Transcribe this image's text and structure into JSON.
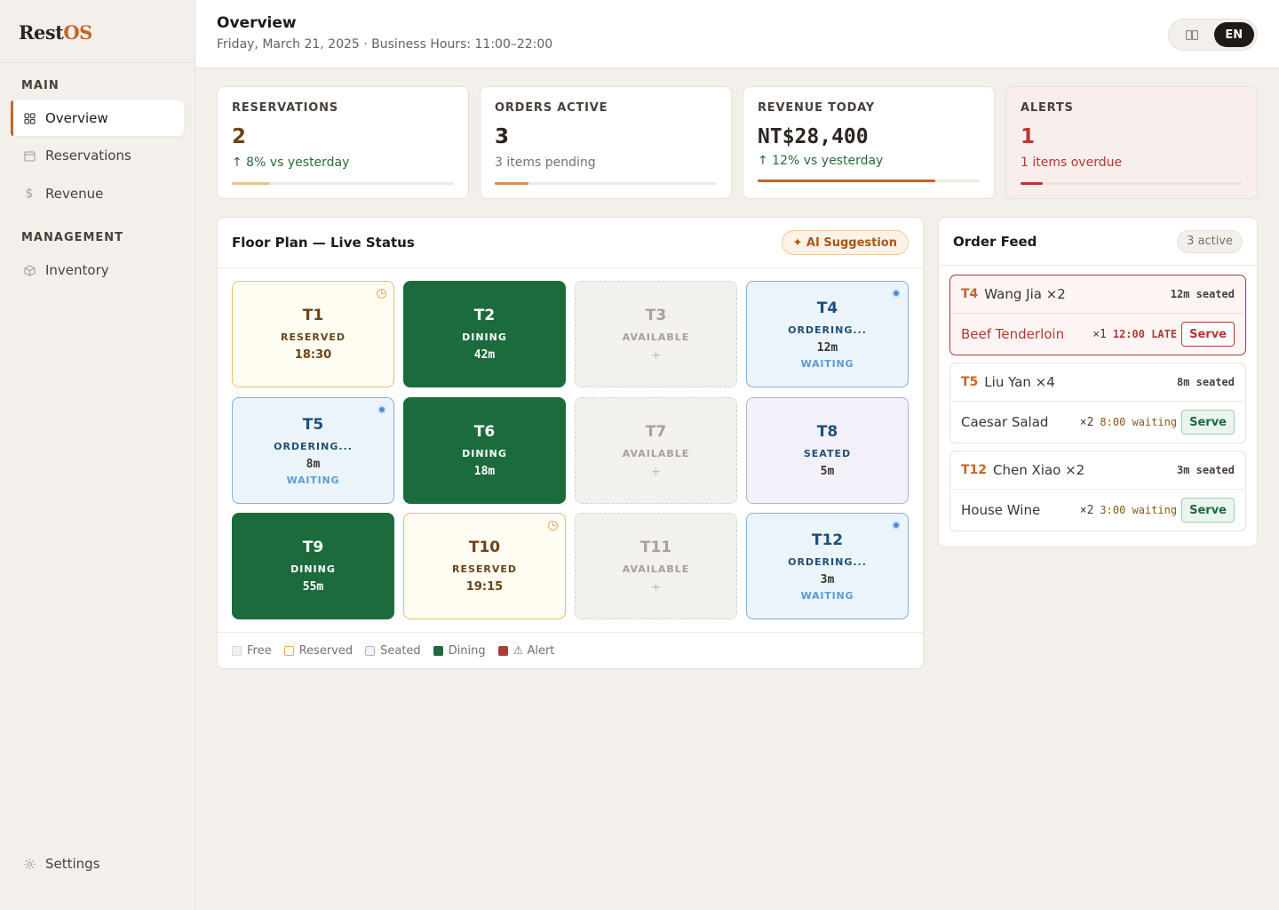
{
  "brand": {
    "part1": "Rest",
    "part2": "OS"
  },
  "sidebar": {
    "section_main": "MAIN",
    "section_management": "MANAGEMENT",
    "items": [
      {
        "label": "Overview",
        "icon": "grid-icon"
      },
      {
        "label": "Reservations",
        "icon": "calendar-icon"
      },
      {
        "label": "Revenue",
        "icon": "dollar-icon"
      },
      {
        "label": "Inventory",
        "icon": "box-icon"
      }
    ],
    "settings": {
      "label": "Settings",
      "icon": "gear-icon"
    }
  },
  "header": {
    "title": "Overview",
    "subtitle": "Friday, March 21, 2025 · Business Hours: 11:00–22:00",
    "lang": {
      "options": [
        "中",
        "EN"
      ],
      "active": "EN"
    }
  },
  "stats": [
    {
      "label": "RESERVATIONS",
      "value": "2",
      "note": "↑ 8% vs yesterday",
      "progress": 0.17,
      "bar_color": "#e8c28f"
    },
    {
      "label": "ORDERS ACTIVE",
      "value": "3",
      "note": "3 items pending",
      "progress": 0.15,
      "bar_color": "#d98a5a"
    },
    {
      "label": "REVENUE TODAY",
      "value": "NT$28,400",
      "note": "↑ 12% vs yesterday",
      "progress": 0.8,
      "bar_color": "#c4652a"
    },
    {
      "label": "ALERTS",
      "value": "1",
      "note": "1 items overdue",
      "progress": 0.1,
      "bar_color": "#b23a32"
    }
  ],
  "floor": {
    "title": "Floor Plan — Live Status",
    "ai_button": "✦ AI Suggestion",
    "tables": [
      {
        "name": "T1",
        "status": "RESERVED",
        "time": "18:30"
      },
      {
        "name": "T2",
        "status": "DINING",
        "time": "42m"
      },
      {
        "name": "T3",
        "status": "AVAILABLE",
        "time": "+"
      },
      {
        "name": "T4",
        "status": "ORDERING...",
        "time": "12m",
        "wait": "WAITING"
      },
      {
        "name": "T5",
        "status": "ORDERING...",
        "time": "8m",
        "wait": "WAITING"
      },
      {
        "name": "T6",
        "status": "DINING",
        "time": "18m"
      },
      {
        "name": "T7",
        "status": "AVAILABLE",
        "time": "+"
      },
      {
        "name": "T8",
        "status": "SEATED",
        "time": "5m"
      },
      {
        "name": "T9",
        "status": "DINING",
        "time": "55m"
      },
      {
        "name": "T10",
        "status": "RESERVED",
        "time": "19:15"
      },
      {
        "name": "T11",
        "status": "AVAILABLE",
        "time": "+"
      },
      {
        "name": "T12",
        "status": "ORDERING...",
        "time": "3m",
        "wait": "WAITING"
      }
    ],
    "legend": [
      "Free",
      "Reserved",
      "Seated",
      "Dining",
      "⚠ Alert"
    ]
  },
  "feed": {
    "title": "Order Feed",
    "count": "3 active",
    "orders": [
      {
        "table": "T4",
        "guest": "Wang Jia ×2",
        "seated": "12m seated",
        "item": "Beef Tenderloin",
        "qty": "×1",
        "wait": "12:00 LATE",
        "action": "Serve"
      },
      {
        "table": "T5",
        "guest": "Liu Yan ×4",
        "seated": "8m seated",
        "item": "Caesar Salad",
        "qty": "×2",
        "wait": "8:00 waiting",
        "action": "Serve"
      },
      {
        "table": "T12",
        "guest": "Chen Xiao ×2",
        "seated": "3m seated",
        "item": "House Wine",
        "qty": "×2",
        "wait": "3:00 waiting",
        "action": "Serve"
      }
    ]
  },
  "colors": {
    "accent": "#c4652a",
    "dining": "#1b6b3c",
    "alert": "#b23a32",
    "ordering": "#4a90d9"
  }
}
